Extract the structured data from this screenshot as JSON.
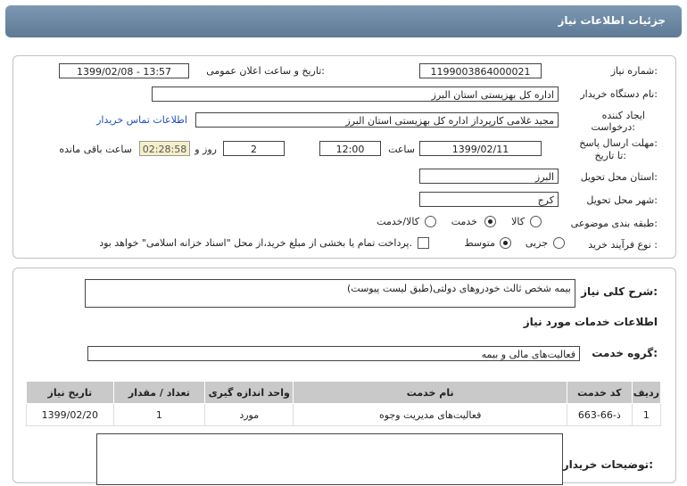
{
  "header": {
    "title": "جزئیات اطلاعات نیاز"
  },
  "form": {
    "need_number_label": "شماره نیاز:",
    "need_number": "1199003864000021",
    "announce_label": "تاریخ و ساعت اعلان عمومی:",
    "announce_value": "1399/02/08 - 13:57",
    "buyer_org_label": "نام دستگاه خریدار:",
    "buyer_org": "اداره کل بهزیستی استان البرز",
    "creator_label_1": "ایجاد کننده",
    "creator_label_2": "درخواست:",
    "creator": "مجید غلامی کارپرداز اداره کل بهزیستی استان البرز",
    "contact_link": "اطلاعات تماس خریدار",
    "deadline_label_1": "مهلت ارسال پاسخ:",
    "deadline_label_2": "تا تاریخ:",
    "deadline_date": "1399/02/11",
    "time_label": "ساعت",
    "deadline_time": "12:00",
    "days_value": "2",
    "days_label": "روز و",
    "remaining_time": "02:28:58",
    "remaining_label": "ساعت باقی مانده",
    "province_label": "استان محل تحویل:",
    "province": "البرز",
    "city_label": "شهر محل تحویل:",
    "city": "کرج",
    "category_label": "طبقه بندی موضوعی:",
    "category_options": [
      "کالا",
      "خدمت",
      "کالا/خدمت"
    ],
    "process_label": "نوع فرآیند خرید :",
    "process_options": [
      "جزیی",
      "متوسط"
    ],
    "payment_note": "پرداخت تمام یا بخشی از مبلغ خرید،از محل \"اسناد خزانه اسلامی\" خواهد بود."
  },
  "details": {
    "description_label": "شرح کلی نیاز:",
    "description": "بیمه شخص ثالث خودروهای دولتی(طبق لیست پیوست)",
    "services_heading": "اطلاعات خدمات مورد نیاز",
    "service_group_label": "گروه خدمت:",
    "service_group": "فعالیت‌های مالی و بیمه",
    "table_headers": [
      "ردیف",
      "کد خدمت",
      "نام خدمت",
      "واحد اندازه گیری",
      "تعداد / مقدار",
      "تاریخ نیاز"
    ],
    "table_rows": [
      [
        "1",
        "ذ-66-663",
        "فعالیت‌های مدیریت وجوه",
        "مورد",
        "1",
        "1399/02/20"
      ]
    ],
    "buyer_notes_label": "توضیحات خریدار:"
  }
}
